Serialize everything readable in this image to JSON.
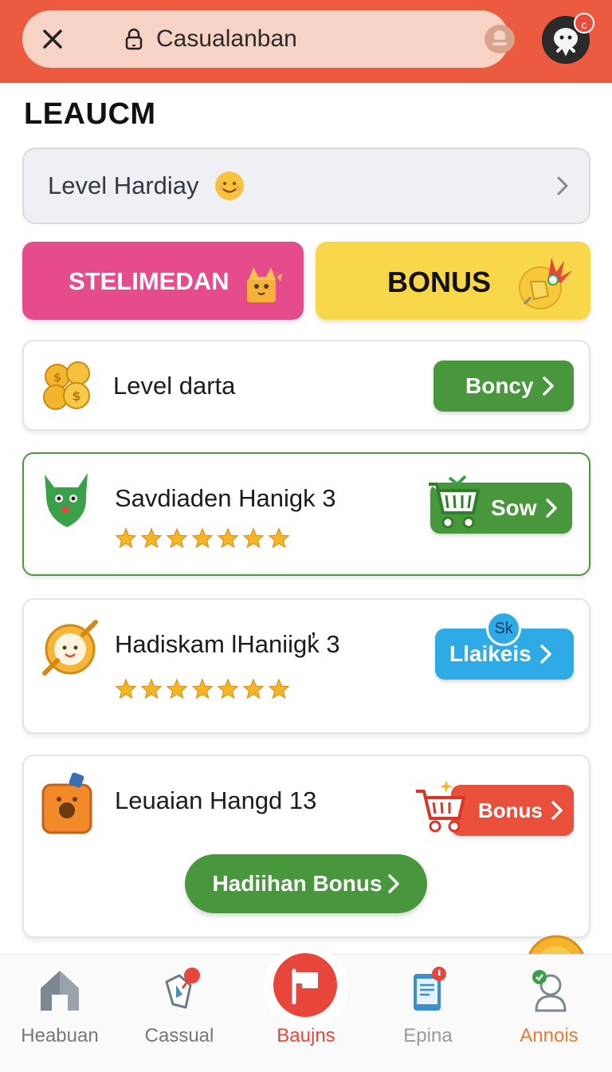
{
  "header": {
    "url": "Casualanban",
    "avatar_badge": "c"
  },
  "page_title": "LEAUCM",
  "level_select": {
    "label": "Level Hardiay"
  },
  "promos": [
    {
      "label": "STELIMEDAN"
    },
    {
      "label": "BONUS"
    }
  ],
  "cards": [
    {
      "title": "Level darta",
      "button": "Boncy"
    },
    {
      "title": "Savdiaden Hanigk 3",
      "button": "Sow",
      "rating": 7
    },
    {
      "title": "Hadiskam lHaniigk̓ 3",
      "button": "Llaikeis",
      "button_badge": "Sk",
      "rating": 7
    },
    {
      "title": "Leuaian Hangd 13",
      "button": "Bonus",
      "cta": "Hadiihan Bonus"
    }
  ],
  "nav": [
    {
      "label": "Heabuan",
      "icon": "home-icon"
    },
    {
      "label": "Cassual",
      "icon": "map-pin-icon"
    },
    {
      "label": "Baujns",
      "icon": "flag-icon",
      "active": true
    },
    {
      "label": "Epina",
      "icon": "tablet-icon"
    },
    {
      "label": "Annois",
      "icon": "profile-icon"
    }
  ],
  "colors": {
    "header": "#ec5b3f",
    "accent_green": "#48973d",
    "accent_blue": "#2eaae6",
    "accent_red": "#e8503b",
    "promo_pink": "#e64b8c",
    "promo_yellow": "#f8d84a",
    "nav_active": "#e8453b",
    "nav_orange": "#e67a2e"
  }
}
